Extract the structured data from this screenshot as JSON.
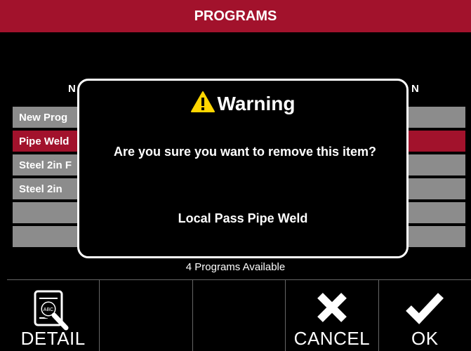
{
  "header": {
    "title": "PROGRAMS"
  },
  "columns": {
    "name": "N",
    "description": "N"
  },
  "programs": [
    {
      "label": "New Prog"
    },
    {
      "label": "Pipe Weld"
    },
    {
      "label": "Steel 2in F"
    },
    {
      "label": "Steel 2in"
    },
    {
      "label": ""
    },
    {
      "label": ""
    }
  ],
  "status": "4 Programs Available",
  "toolbar": {
    "detail_label": "DETAIL",
    "cancel_label": "CANCEL",
    "ok_label": "OK",
    "icons": [
      "search-document-icon",
      "close-icon",
      "check-icon"
    ]
  },
  "dialog": {
    "title": "Warning",
    "message": "Are you sure you want to remove this item?",
    "item": "Local Pass Pipe Weld",
    "icon": "warning-icon"
  },
  "colors": {
    "header": "#a2122c",
    "selected_row": "#a2122c",
    "row": "#8c8c8c",
    "warning": "#ffd600"
  }
}
